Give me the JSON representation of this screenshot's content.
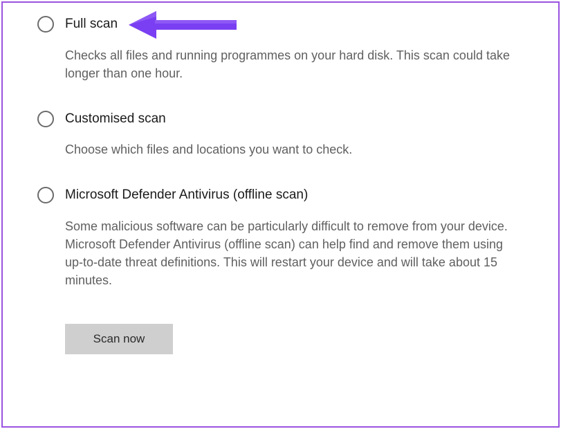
{
  "options": [
    {
      "id": "full-scan",
      "title": "Full scan",
      "desc": "Checks all files and running programmes on your hard disk. This scan could take longer than one hour."
    },
    {
      "id": "customised-scan",
      "title": "Customised scan",
      "desc": "Choose which files and locations you want to check."
    },
    {
      "id": "offline-scan",
      "title": "Microsoft Defender Antivirus (offline scan)",
      "desc": "Some malicious software can be particularly difficult to remove from your device. Microsoft Defender Antivirus (offline scan) can help find and remove them using up-to-date threat definitions. This will restart your device and will take about 15 minutes."
    }
  ],
  "scan_button_label": "Scan now",
  "annotation": {
    "arrow_color": "#7a3ff2"
  }
}
